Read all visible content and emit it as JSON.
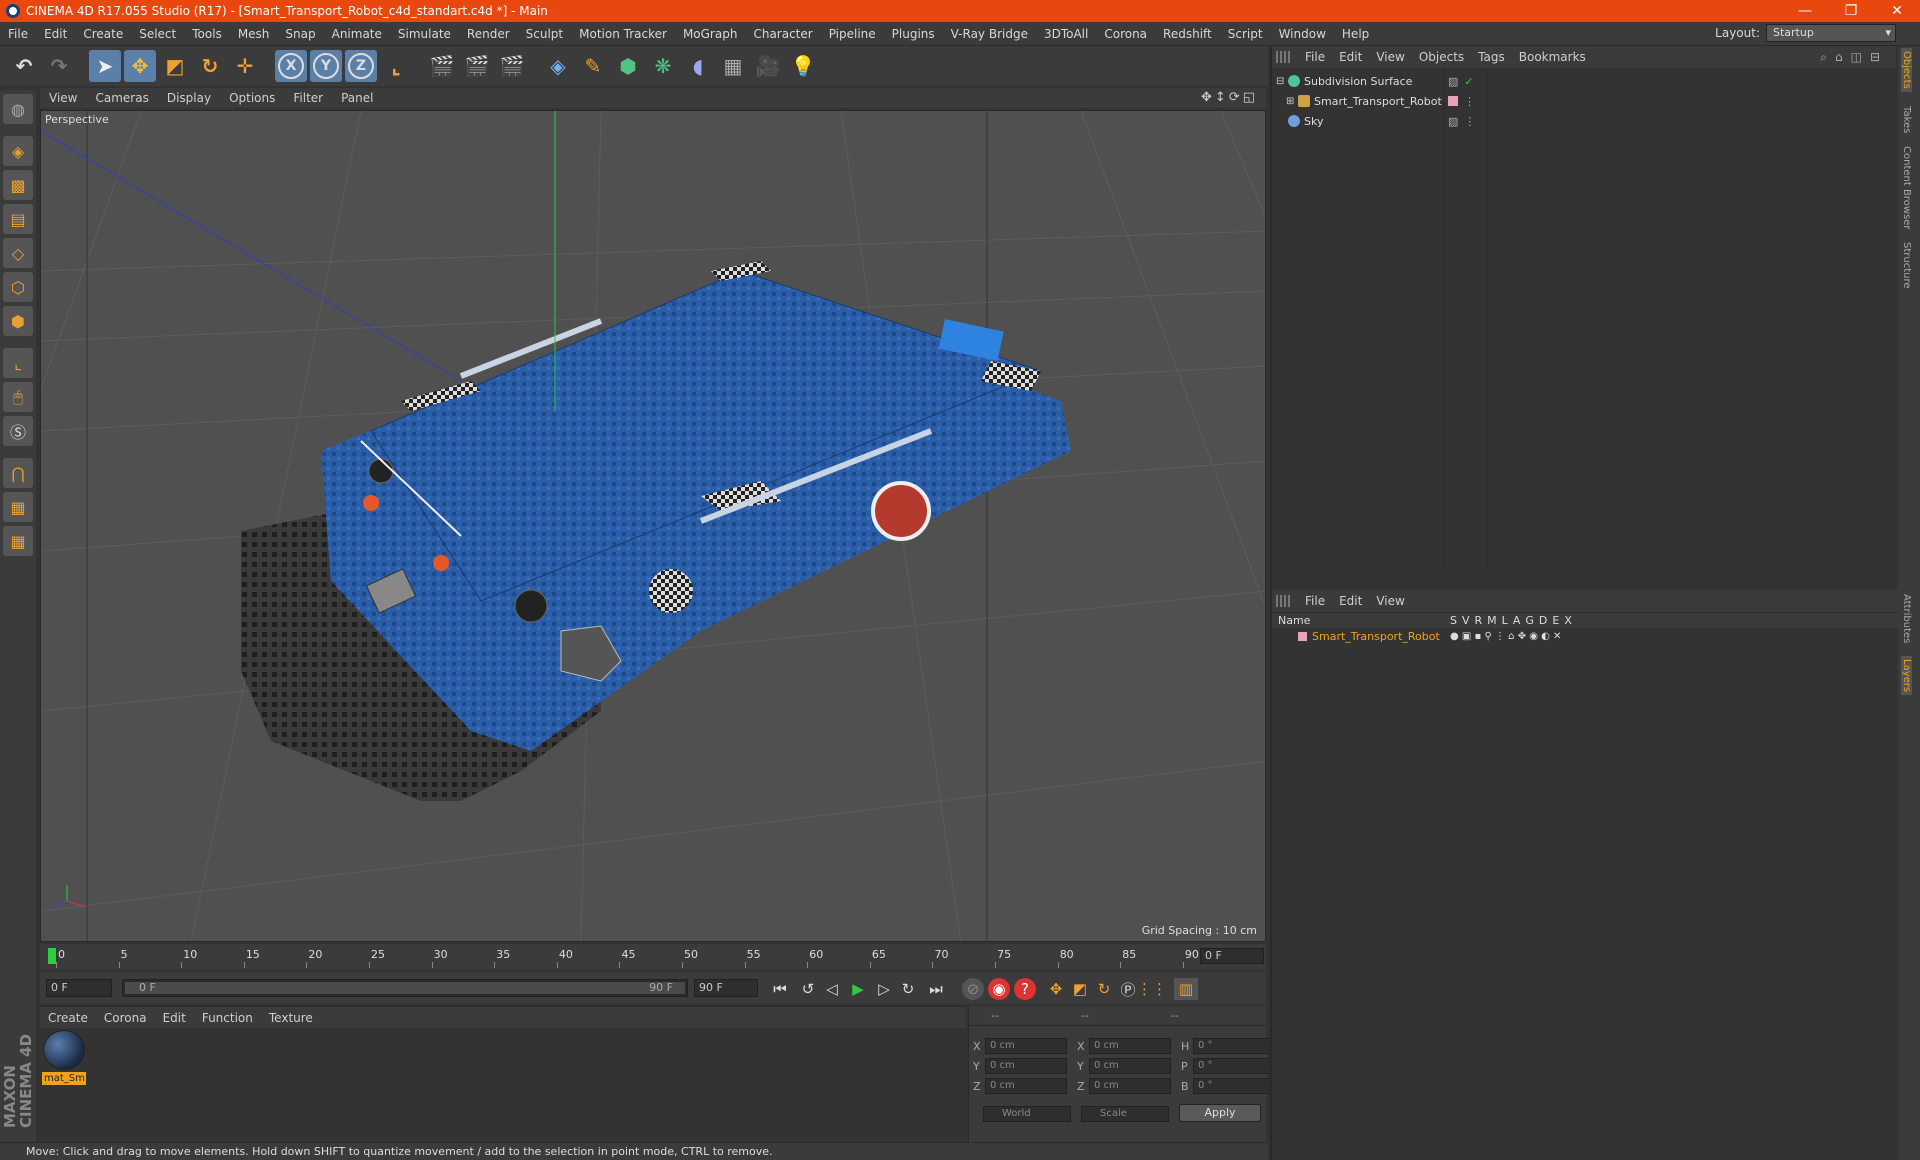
{
  "window": {
    "title": "CINEMA 4D R17.055 Studio (R17) - [Smart_Transport_Robot_c4d_standart.c4d *] - Main",
    "minimize": "—",
    "maximize": "❐",
    "close": "✕"
  },
  "menu": [
    "File",
    "Edit",
    "Create",
    "Select",
    "Tools",
    "Mesh",
    "Snap",
    "Animate",
    "Simulate",
    "Render",
    "Sculpt",
    "Motion Tracker",
    "MoGraph",
    "Character",
    "Pipeline",
    "Plugins",
    "V-Ray Bridge",
    "3DToAll",
    "Corona",
    "Redshift",
    "Script",
    "Window",
    "Help"
  ],
  "layout": {
    "label": "Layout:",
    "value": "Startup"
  },
  "viewport": {
    "menu": [
      "View",
      "Cameras",
      "Display",
      "Options",
      "Filter",
      "Panel"
    ],
    "camera_label": "Perspective",
    "grid_spacing": "Grid Spacing : 10 cm"
  },
  "timeline": {
    "ticks": [
      "0",
      "5",
      "10",
      "15",
      "20",
      "25",
      "30",
      "35",
      "40",
      "45",
      "50",
      "55",
      "60",
      "65",
      "70",
      "75",
      "80",
      "85",
      "90"
    ],
    "current_frame": "0 F"
  },
  "transport": {
    "start": "0 F",
    "slider_start": "0 F",
    "slider_end": "90 F",
    "end": "90 F"
  },
  "materials": {
    "menu": [
      "Create",
      "Corona",
      "Edit",
      "Function",
      "Texture"
    ],
    "items": [
      {
        "name": "mat_Sm"
      }
    ]
  },
  "coordinates": {
    "header": [
      "--",
      "--",
      "--"
    ],
    "rows": [
      {
        "a": "X",
        "a_val": "0 cm",
        "b": "X",
        "b_val": "0 cm",
        "c": "H",
        "c_val": "0 °"
      },
      {
        "a": "Y",
        "a_val": "0 cm",
        "b": "Y",
        "b_val": "0 cm",
        "c": "P",
        "c_val": "0 °"
      },
      {
        "a": "Z",
        "a_val": "0 cm",
        "b": "Z",
        "b_val": "0 cm",
        "c": "B",
        "c_val": "0 °"
      }
    ],
    "space": "World",
    "mode": "Scale",
    "apply": "Apply"
  },
  "status": "Move: Click and drag to move elements. Hold down SHIFT to quantize movement / add to the selection in point mode, CTRL to remove.",
  "objects": {
    "menu": [
      "File",
      "Edit",
      "View",
      "Objects",
      "Tags",
      "Bookmarks"
    ],
    "items": [
      {
        "name": "Subdivision Surface",
        "icon_color": "#4fc3a1"
      },
      {
        "name": "Smart_Transport_Robot",
        "icon_color": "#cfa24a"
      },
      {
        "name": "Sky",
        "icon_color": "#6f9fd8"
      }
    ]
  },
  "layers": {
    "menu": [
      "File",
      "Edit",
      "View"
    ],
    "name_col": "Name",
    "cols": [
      "S",
      "V",
      "R",
      "M",
      "L",
      "A",
      "G",
      "D",
      "E",
      "X"
    ],
    "items": [
      {
        "name": "Smart_Transport_Robot",
        "color": "#e9a3b6"
      }
    ]
  },
  "side_tabs": [
    "Objects",
    "Takes",
    "Content Browser",
    "Structure",
    "Attributes",
    "Layers"
  ],
  "maxon": "MAXON CINEMA 4D"
}
